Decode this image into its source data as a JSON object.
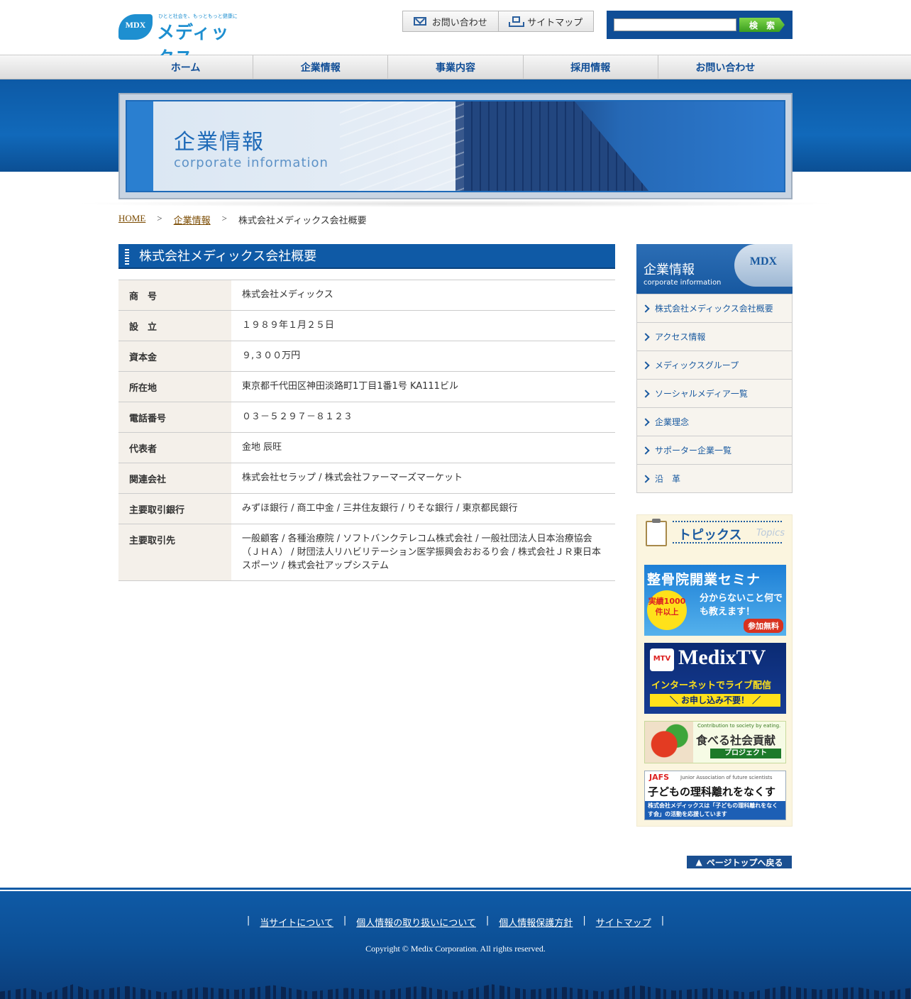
{
  "header": {
    "logo_badge": "MDX",
    "logo_name": "メディックス",
    "logo_tagline": "ひとと社会を、もっともっと健康に",
    "links": [
      "お問い合わせ",
      "サイトマップ"
    ],
    "search_button": "検　索",
    "search_placeholder": ""
  },
  "nav": [
    "ホーム",
    "企業情報",
    "事業内容",
    "採用情報",
    "お問い合わせ"
  ],
  "hero": {
    "title": "企業情報",
    "subtitle": "corporate information"
  },
  "breadcrumb": {
    "home": "HOME",
    "sep": ">",
    "section": "企業情報",
    "current": "株式会社メディックス会社概要"
  },
  "main": {
    "heading": "株式会社メディックス会社概要",
    "rows": [
      {
        "label": "商　号",
        "value": "株式会社メディックス"
      },
      {
        "label": "設　立",
        "value": "１９８９年１月２５日"
      },
      {
        "label": "資本金",
        "value": "９,３００万円"
      },
      {
        "label": "所在地",
        "value": "東京都千代田区神田淡路町1丁目1番1号 KA111ビル"
      },
      {
        "label": "電話番号",
        "value": "０３－５２９７－８１２３"
      },
      {
        "label": "代表者",
        "value": "金地 辰旺"
      },
      {
        "label": "関連会社",
        "value": "株式会社セラップ / 株式会社ファーマーズマーケット"
      },
      {
        "label": "主要取引銀行",
        "value": "みずほ銀行 / 商工中金 / 三井住友銀行 / りそな銀行 / 東京都民銀行"
      },
      {
        "label": "主要取引先",
        "value": "一般顧客 / 各種治療院 / ソフトバンクテレコム株式会社 / 一般社団法人日本治療協会（ＪＨＡ） / 財団法人リハビリテーション医学振興会おおるり会 / 株式会社ＪＲ東日本スポーツ / 株式会社アップシステム"
      }
    ]
  },
  "sidebar": {
    "title": "企業情報",
    "subtitle": "corporate information",
    "badge": "MDX",
    "items": [
      "株式会社メディックス会社概要",
      "アクセス情報",
      "メディックスグループ",
      "ソーシャルメディア一覧",
      "企業理念",
      "サポーター企業一覧",
      "沿　革"
    ],
    "topics_title": "トピックス",
    "topics_sub": "Topics",
    "banners": {
      "b1_title": "整骨院開業セミナ",
      "b1_circle": "実績1000件以上",
      "b1_text": "分からないこと何でも教えます！",
      "b1_tag": "参加無料",
      "b2_logo": "MTV",
      "b2_title": "MedixTV",
      "b2_text": "インターネットでライブ配信",
      "b2_bar": "＼ お申し込み不要！ ／",
      "b3_en": "Contribution to society by eating.",
      "b3_title": "食べる社会貢献",
      "b3_tag": "プロジェクト",
      "b4_logo": "JAFS",
      "b4_en": "Junior Association of future scientists",
      "b4_title": "子どもの理科離れをなくす会",
      "b4_note": "株式会社メディックスは「子どもの理科離れをなくす会」の活動を応援しています"
    }
  },
  "pagetop": "ページトップへ戻る",
  "footer": {
    "links": [
      "当サイトについて",
      "個人情報の取り扱いについて",
      "個人情報保護方針",
      "サイトマップ"
    ],
    "copyright": "Copyright © Medix Corporation. All rights reserved."
  }
}
